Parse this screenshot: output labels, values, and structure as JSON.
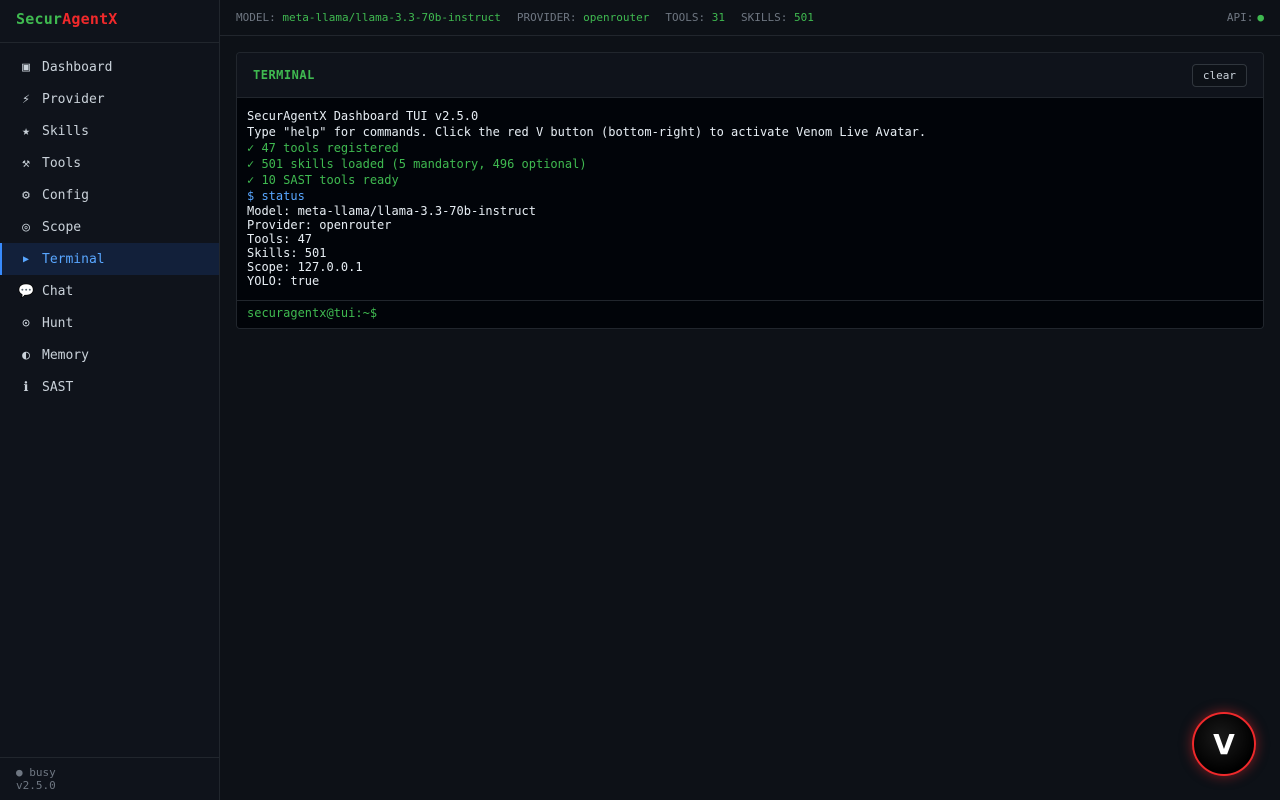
{
  "brand": {
    "part1": "Secur",
    "part2": "AgentX"
  },
  "sidebar": {
    "items": [
      {
        "label": "Dashboard",
        "icon": "dashboard-icon"
      },
      {
        "label": "Provider",
        "icon": "lightning-icon"
      },
      {
        "label": "Skills",
        "icon": "star-icon"
      },
      {
        "label": "Tools",
        "icon": "hammer-icon"
      },
      {
        "label": "Config",
        "icon": "gear-icon"
      },
      {
        "label": "Scope",
        "icon": "target-icon"
      },
      {
        "label": "Terminal",
        "icon": "play-icon",
        "active": true
      },
      {
        "label": "Chat",
        "icon": "chat-icon"
      },
      {
        "label": "Hunt",
        "icon": "crosshair-icon"
      },
      {
        "label": "Memory",
        "icon": "half-circle-icon"
      },
      {
        "label": "SAST",
        "icon": "info-icon"
      }
    ],
    "footer": {
      "status": "● busy",
      "version": "v2.5.0"
    }
  },
  "topbar": {
    "model_label": "MODEL:",
    "model_value": "meta-llama/llama-3.3-70b-instruct",
    "provider_label": "PROVIDER:",
    "provider_value": "openrouter",
    "tools_label": "TOOLS:",
    "tools_value": "31",
    "skills_label": "SKILLS:",
    "skills_value": "501",
    "api_label": "API:",
    "api_status": "●"
  },
  "panel": {
    "title": "TERMINAL",
    "clear_label": "clear"
  },
  "terminal": {
    "lines": [
      "SecurAgentX Dashboard TUI v2.5.0",
      "Type \"help\" for commands. Click the red V button (bottom-right) to activate Venom Live Avatar.",
      "✓ 47 tools registered",
      "✓ 501 skills loaded (5 mandatory, 496 optional)",
      "✓ 10 SAST tools ready",
      "$ status"
    ],
    "output": [
      "Model: meta-llama/llama-3.3-70b-instruct",
      "Provider: openrouter",
      "Tools: 47",
      "Skills: 501",
      "Scope: 127.0.0.1",
      "YOLO: true"
    ],
    "prompt": "securagentx@tui:~$"
  },
  "venom": {
    "label": "V"
  },
  "colors": {
    "accent_green": "#3fb950",
    "accent_red": "#f0292b",
    "accent_blue": "#58a6ff",
    "background": "#0d1117"
  }
}
